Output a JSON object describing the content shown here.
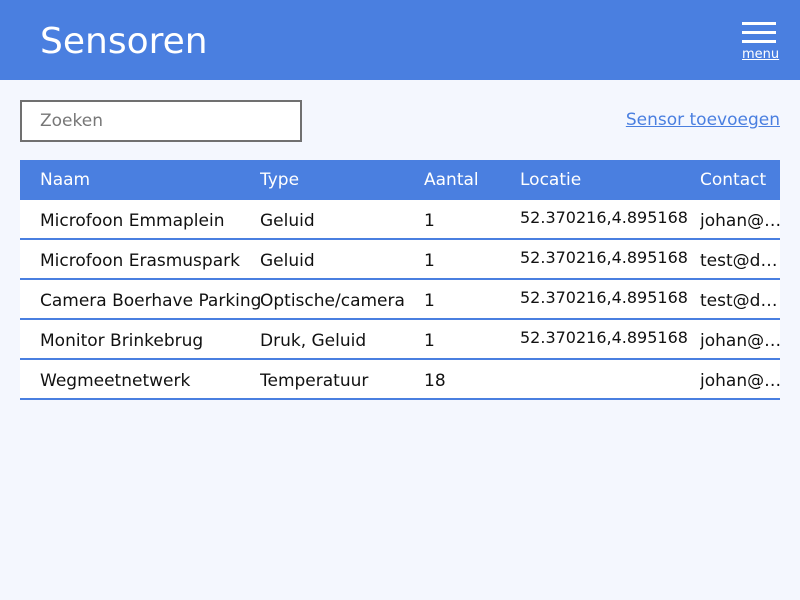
{
  "header": {
    "title": "Sensoren",
    "menu_label": "menu"
  },
  "search": {
    "placeholder": "Zoeken",
    "value": ""
  },
  "actions": {
    "add_sensor": "Sensor toevoegen"
  },
  "table": {
    "columns": [
      "Naam",
      "Type",
      "Aantal",
      "Locatie",
      "Contact"
    ],
    "rows": [
      [
        "Microfoon Emmaplein",
        "Geluid",
        "1",
        "52.370216,4.895168",
        "johan@…"
      ],
      [
        "Microfoon Erasmuspark",
        "Geluid",
        "1",
        "52.370216,4.895168",
        "test@d…"
      ],
      [
        "Camera Boerhave Parking",
        "Optische/camera",
        "1",
        "52.370216,4.895168",
        "test@d…"
      ],
      [
        "Monitor Brinkebrug",
        "Druk, Geluid",
        "1",
        "52.370216,4.895168",
        "johan@…"
      ],
      [
        "Wegmeetnetwerk",
        "Temperatuur",
        "18",
        "",
        "johan@…"
      ]
    ]
  },
  "colors": {
    "accent": "#4a7fe0",
    "background": "#f4f7fe"
  }
}
